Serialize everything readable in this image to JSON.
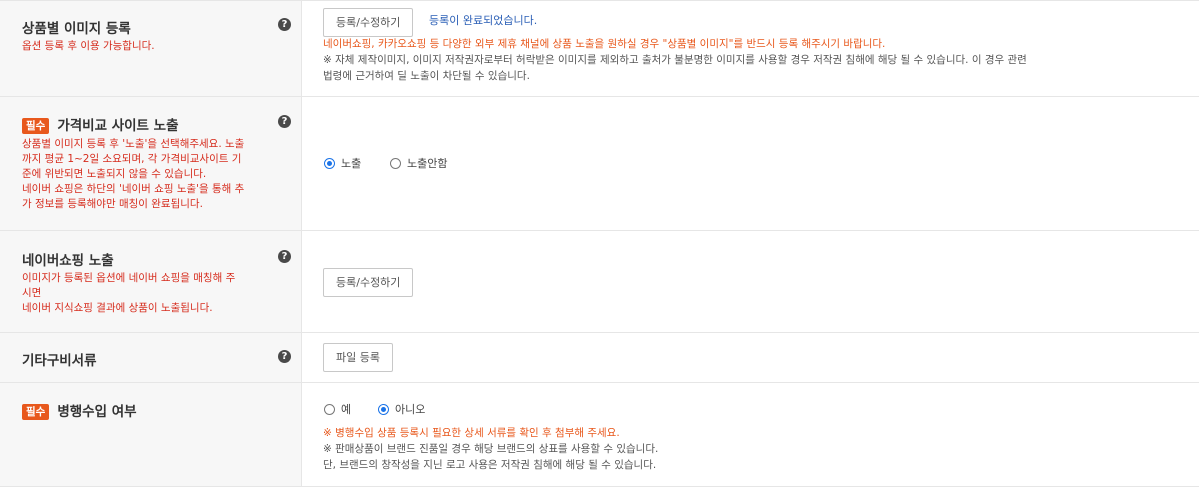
{
  "rows": {
    "image_reg": {
      "title": "상품별 이미지 등록",
      "desc": "옵션 등록 후 이용 가능합니다.",
      "button": "등록/수정하기",
      "status": "등록이 완료되었습니다.",
      "notice_lines": [
        "네이버쇼핑, 카카오쇼핑 등 다양한 외부 제휴 채널에 상품 노출을 원하실 경우 \"상품별 이미지\"를 반드시 등록 해주시기 바랍니다.",
        "※ 자체 제작이미지, 이미지 저작권자로부터 허락받은 이미지를 제외하고 출처가 불분명한 이미지를 사용할 경우 저작권 침해에 해당 될 수 있습니다. 이 경우 관련",
        "법령에 근거하여 딜 노출이 차단될 수 있습니다."
      ]
    },
    "price_compare": {
      "badge": "필수",
      "title": "가격비교 사이트 노출",
      "desc_lines": [
        "상품별 이미지 등록 후 '노출'을 선택해주세요. 노출",
        "까지 평균 1~2일 소요되며, 각 가격비교사이트 기",
        "준에 위반되면 노출되지 않을 수 있습니다.",
        "네이버 쇼핑은 하단의 '네이버 쇼핑 노출'을 통해 추",
        "가 정보를 등록해야만 매칭이 완료됩니다."
      ],
      "options": [
        "노출",
        "노출안함"
      ],
      "selected": "노출"
    },
    "naver_shopping": {
      "title": "네이버쇼핑 노출",
      "desc_lines": [
        "이미지가 등록된 옵션에 네이버 쇼핑을 매칭해 주",
        "시면",
        "네이버 지식쇼핑 결과에 상품이 노출됩니다."
      ],
      "button": "등록/수정하기"
    },
    "other_docs": {
      "title": "기타구비서류",
      "button": "파일 등록"
    },
    "parallel_import": {
      "badge": "필수",
      "title": "병행수입 여부",
      "options": [
        "예",
        "아니오"
      ],
      "selected": "아니오",
      "notice_lines": [
        "※ 병행수입 상품 등록시 필요한 상세 서류를 확인 후 첨부해 주세요.",
        "※ 판매상품이 브랜드 진품일 경우 해당 브랜드의 상표를 사용할 수 있습니다.",
        "단, 브랜드의 창작성을 지닌 로고 사용은 저작권 침해에 해당 될 수 있습니다."
      ]
    }
  },
  "icons": {
    "help": "?"
  },
  "colors": {
    "required_badge": "#e8581c",
    "error_text": "#d62c1d",
    "status_text": "#2b5fb6",
    "radio_active": "#1a73e8"
  }
}
